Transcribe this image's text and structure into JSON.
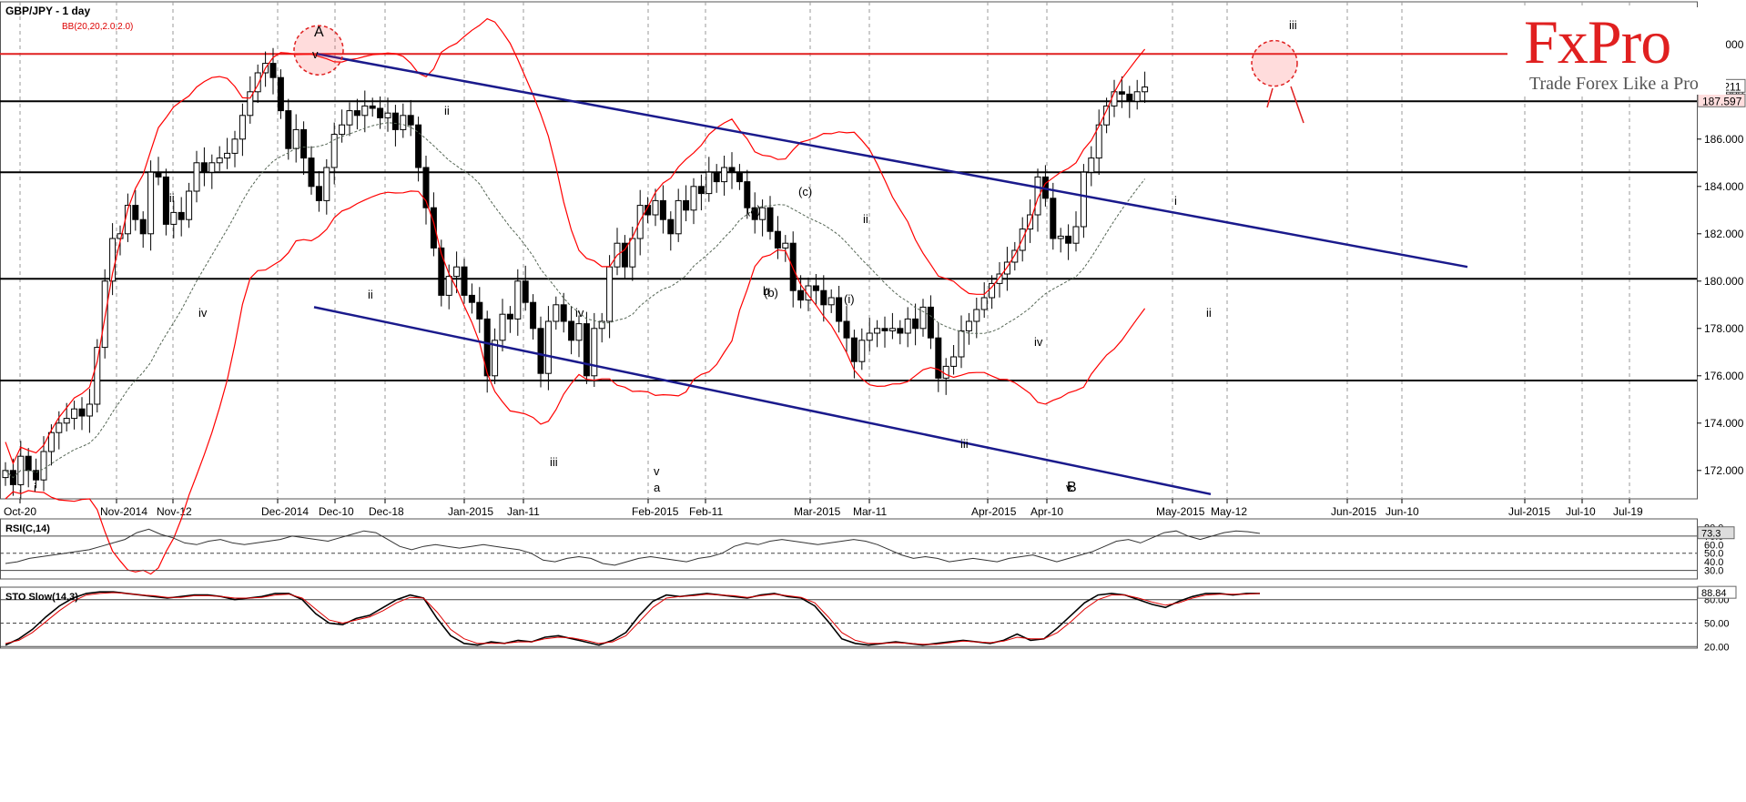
{
  "header": {
    "symbol": "GBP/JPY - 1 day",
    "indicator": "BB(20,20,2.0,2.0)"
  },
  "logo": {
    "brand": "FxPro",
    "tagline": "Trade Forex Like a Pro"
  },
  "colors": {
    "up_candle": "#ffffff",
    "down_candle": "#000000",
    "bollinger": "#ff0000",
    "sma": "#556655",
    "channel": "#1a1a8c",
    "resistance": "#e02020",
    "support": "#000000"
  },
  "chart_data": [
    {
      "type": "candlestick",
      "title": "GBP/JPY - 1 day",
      "ylim": [
        170.8,
        191.8
      ],
      "y_ticks": [
        "172.000",
        "174.000",
        "176.000",
        "178.000",
        "180.000",
        "182.000",
        "184.000",
        "186.000",
        "188.000",
        "190.000"
      ],
      "x_tick_labels": [
        "Oct-20",
        "Nov-2014",
        "Nov-12",
        "Dec-2014",
        "Dec-10",
        "Dec-18",
        "Jan-2015",
        "Jan-11",
        "Feb-2015",
        "Feb-11",
        "Mar-2015",
        "Mar-11",
        "Apr-2015",
        "Apr-10",
        "May-2015",
        "May-12",
        "Jun-2015",
        "Jun-10",
        "Jul-2015",
        "Jul-10",
        "Jul-19"
      ],
      "price_labels": [
        "188.211",
        "187.597"
      ],
      "close": [
        172.0,
        171.4,
        172.6,
        172.0,
        171.6,
        172.8,
        173.6,
        174.0,
        174.2,
        174.6,
        174.3,
        174.8,
        177.2,
        180.0,
        181.8,
        182.0,
        183.2,
        182.6,
        182.0,
        184.6,
        184.4,
        182.4,
        182.9,
        182.6,
        183.8,
        185.0,
        184.6,
        185.0,
        185.2,
        185.4,
        186.0,
        187.0,
        188.0,
        188.8,
        189.2,
        188.6,
        187.2,
        185.6,
        186.4,
        185.2,
        184.0,
        183.4,
        184.8,
        186.2,
        186.6,
        187.2,
        187.0,
        187.4,
        187.3,
        186.9,
        187.1,
        186.4,
        187.0,
        186.6,
        184.8,
        183.1,
        181.4,
        179.4,
        180.2,
        180.6,
        179.4,
        179.1,
        178.4,
        176.0,
        177.5,
        178.6,
        178.4,
        180.0,
        179.1,
        178.0,
        176.1,
        178.3,
        179.0,
        178.3,
        177.5,
        178.2,
        176.0,
        178.0,
        178.3,
        180.6,
        181.6,
        180.6,
        181.8,
        183.2,
        182.8,
        183.4,
        182.6,
        182.0,
        183.4,
        183.0,
        184.0,
        183.7,
        184.6,
        184.2,
        184.8,
        184.6,
        184.2,
        183.1,
        182.6,
        183.1,
        182.1,
        181.4,
        181.6,
        179.6,
        179.2,
        179.8,
        179.6,
        179.0,
        179.3,
        178.3,
        177.6,
        176.6,
        177.5,
        177.8,
        178.0,
        177.9,
        178.0,
        177.8,
        178.4,
        178.0,
        178.9,
        177.6,
        175.9,
        176.4,
        176.8,
        177.9,
        178.3,
        178.8,
        179.3,
        179.9,
        180.3,
        180.8,
        181.3,
        182.2,
        182.8,
        184.4,
        183.5,
        181.8,
        181.9,
        181.6,
        182.3,
        184.6,
        185.2,
        186.6,
        187.4,
        188.0,
        187.9,
        187.6,
        188.0,
        188.2
      ],
      "series": [
        {
          "name": "BB(20,20,2.0,2.0)"
        }
      ],
      "annotations": {
        "wave_labels": [
          "A",
          "v",
          "ii",
          "iii",
          "iv",
          "i",
          "ii",
          "iii",
          "iv",
          "v",
          "a",
          "b",
          "c",
          "(a)",
          "(b)",
          "(c)",
          "ii",
          "(i)",
          "iv",
          "iii",
          "v",
          "c",
          "B",
          "i",
          "ii",
          "iii"
        ],
        "resistance_level": 189.6,
        "support_levels": [
          187.6,
          184.6,
          180.1,
          175.8
        ],
        "channel": {
          "upper": [
            [
              30,
              189.6
            ],
            [
              135,
              180.6
            ]
          ],
          "lower": [
            [
              30,
              178.9
            ],
            [
              135,
              169.9
            ]
          ]
        },
        "target_circle": 189.2,
        "top_circle": 189.6
      }
    },
    {
      "type": "line",
      "title": "RSI(C,14)",
      "ylim": [
        20,
        90
      ],
      "y_ticks": [
        "30.0",
        "40.0",
        "50.0",
        "60.0",
        "70.0",
        "80.0"
      ],
      "current": "73.3",
      "overbought": 70,
      "oversold": 30,
      "values": [
        38,
        40,
        44,
        46,
        48,
        50,
        52,
        54,
        58,
        62,
        66,
        74,
        78,
        72,
        68,
        62,
        60,
        64,
        66,
        62,
        60,
        62,
        64,
        66,
        70,
        68,
        66,
        64,
        68,
        72,
        76,
        74,
        66,
        58,
        54,
        58,
        60,
        58,
        56,
        58,
        60,
        58,
        56,
        54,
        50,
        42,
        40,
        44,
        46,
        44,
        38,
        36,
        40,
        44,
        46,
        44,
        42,
        40,
        44,
        46,
        50,
        58,
        62,
        60,
        64,
        66,
        64,
        62,
        60,
        62,
        64,
        66,
        64,
        60,
        54,
        48,
        44,
        46,
        44,
        40,
        42,
        44,
        42,
        40,
        44,
        46,
        48,
        44,
        40,
        44,
        48,
        52,
        58,
        64,
        66,
        62,
        68,
        74,
        76,
        70,
        66,
        70,
        74,
        76,
        75,
        73
      ]
    },
    {
      "type": "line",
      "title": "STO Slow(14,3)",
      "ylim": [
        18,
        96
      ],
      "y_ticks": [
        "20.00",
        "50.00",
        "80.00"
      ],
      "current": "88.84",
      "series": [
        {
          "values": [
            22,
            30,
            42,
            58,
            72,
            82,
            88,
            90,
            90,
            88,
            86,
            84,
            82,
            84,
            86,
            86,
            84,
            80,
            82,
            84,
            88,
            88,
            80,
            62,
            50,
            48,
            56,
            60,
            70,
            80,
            86,
            82,
            56,
            34,
            24,
            22,
            26,
            24,
            28,
            26,
            32,
            34,
            30,
            26,
            22,
            28,
            38,
            60,
            78,
            86,
            84,
            86,
            88,
            86,
            84,
            82,
            86,
            88,
            84,
            82,
            72,
            52,
            30,
            24,
            22,
            24,
            26,
            24,
            22,
            24,
            26,
            28,
            26,
            24,
            28,
            36,
            28,
            30,
            44,
            60,
            76,
            86,
            88,
            86,
            80,
            74,
            70,
            78,
            84,
            88,
            88,
            86,
            88,
            88
          ]
        },
        {
          "values": [
            24,
            28,
            38,
            52,
            66,
            78,
            86,
            88,
            89,
            88,
            86,
            85,
            83,
            83,
            85,
            85,
            84,
            82,
            82,
            83,
            86,
            87,
            82,
            68,
            54,
            50,
            54,
            58,
            66,
            76,
            83,
            82,
            64,
            42,
            30,
            24,
            24,
            24,
            26,
            26,
            30,
            32,
            31,
            28,
            24,
            26,
            34,
            52,
            70,
            82,
            84,
            85,
            87,
            86,
            85,
            83,
            85,
            87,
            85,
            83,
            76,
            58,
            38,
            28,
            24,
            24,
            25,
            24,
            23,
            23,
            25,
            27,
            26,
            25,
            27,
            32,
            30,
            30,
            38,
            52,
            68,
            80,
            86,
            86,
            82,
            77,
            73,
            76,
            82,
            86,
            87,
            87,
            87,
            88
          ]
        }
      ]
    }
  ]
}
